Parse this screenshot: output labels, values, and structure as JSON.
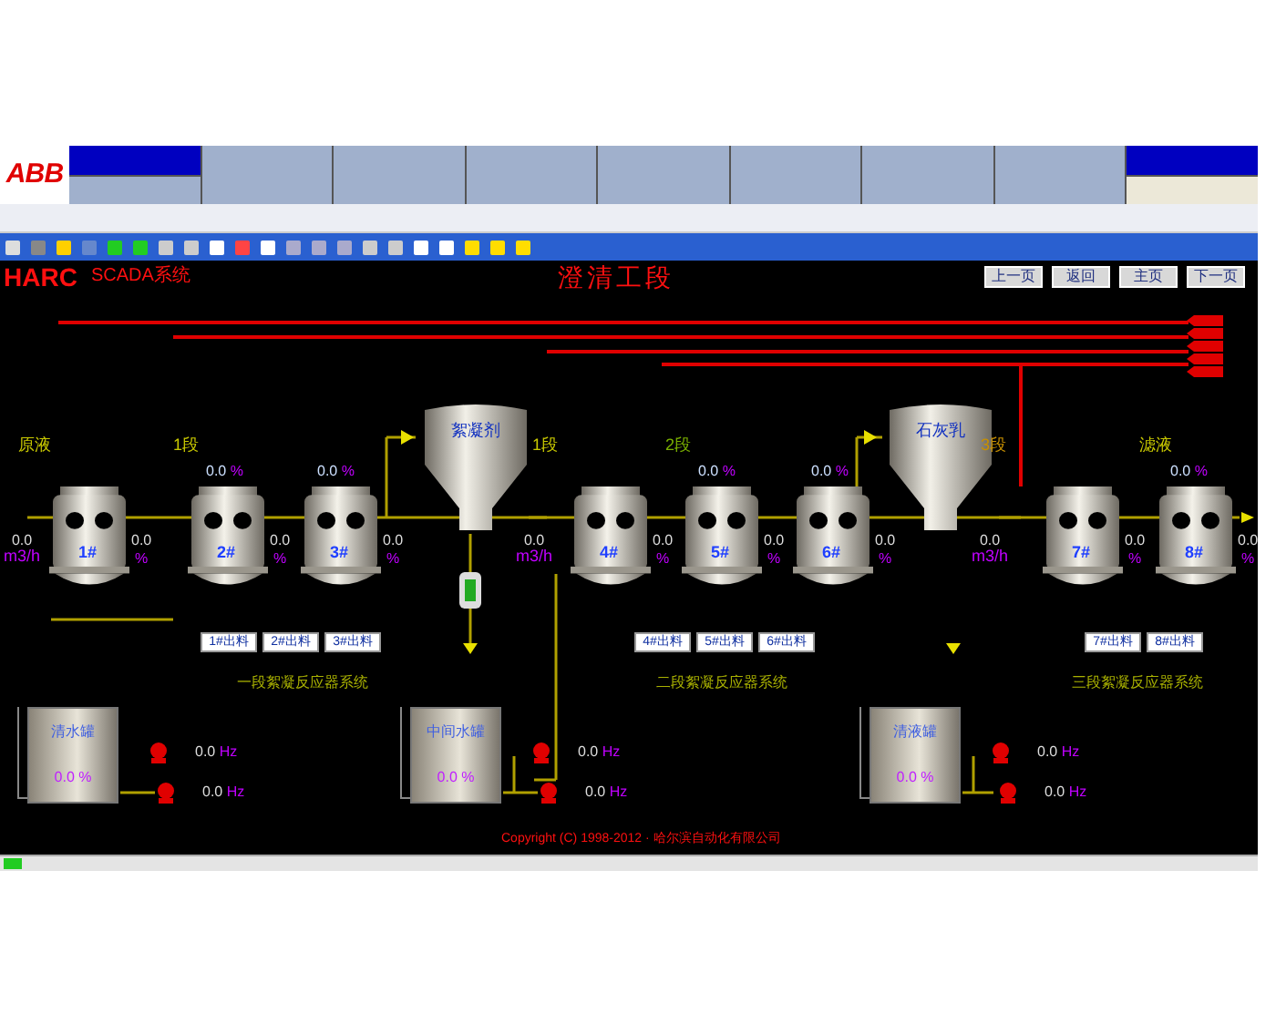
{
  "logo": "ABB",
  "screen": {
    "brand": "HARC",
    "subtitle": "SCADA系统",
    "title": "澄清工段",
    "nav_buttons": [
      "上一页",
      "返回",
      "主页",
      "下一页"
    ],
    "stage_labels": [
      "原液",
      "1段",
      "1段",
      "2段",
      "3段",
      "滤液"
    ],
    "flows": [
      {
        "value": "0.0",
        "unit": "m3/h"
      },
      {
        "value": "0.0",
        "unit": "m3/h"
      },
      {
        "value": "0.0",
        "unit": "m3/h"
      }
    ],
    "top_readings": [
      {
        "value": "0.0",
        "unit": "%"
      },
      {
        "value": "0.0",
        "unit": "%"
      },
      {
        "value": "0.0",
        "unit": "%"
      },
      {
        "value": "0.0",
        "unit": "%"
      },
      {
        "value": "0.0",
        "unit": "%"
      }
    ],
    "reactors": [
      {
        "label": "1#",
        "reading": "0.0",
        "unit": "%"
      },
      {
        "label": "2#",
        "reading": "0.0",
        "unit": "%"
      },
      {
        "label": "3#",
        "reading": "0.0",
        "unit": "%"
      },
      {
        "label": "4#",
        "reading": "0.0",
        "unit": "%"
      },
      {
        "label": "5#",
        "reading": "0.0",
        "unit": "%"
      },
      {
        "label": "6#",
        "reading": "0.0",
        "unit": "%"
      },
      {
        "label": "7#",
        "reading": "0.0",
        "unit": "%"
      },
      {
        "label": "8#",
        "reading": "0.0",
        "unit": "%"
      }
    ],
    "hoppers": [
      "絮凝剂",
      "石灰乳"
    ],
    "button_groups": [
      [
        "1#出料",
        "2#出料",
        "3#出料"
      ],
      [
        "4#出料",
        "5#出料",
        "6#出料"
      ],
      [
        "7#出料",
        "8#出料"
      ]
    ],
    "captions": [
      "一段絮凝反应器系统",
      "二段絮凝反应器系统",
      "三段絮凝反应器系统"
    ],
    "tanks": [
      {
        "name": "清水罐",
        "level_text": "0.0 %",
        "pumps": [
          {
            "value": "0.0",
            "unit": "Hz"
          },
          {
            "value": "0.0",
            "unit": "Hz"
          }
        ]
      },
      {
        "name": "中间水罐",
        "level_text": "0.0 %",
        "pumps": [
          {
            "value": "0.0",
            "unit": "Hz"
          },
          {
            "value": "0.0",
            "unit": "Hz"
          }
        ]
      },
      {
        "name": "清液罐",
        "level_text": "0.0 %",
        "pumps": [
          {
            "value": "0.0",
            "unit": "Hz"
          },
          {
            "value": "0.0",
            "unit": "Hz"
          }
        ]
      }
    ],
    "copyright": "Copyright (C) 1998-2012 · 哈尔滨自动化有限公司"
  }
}
